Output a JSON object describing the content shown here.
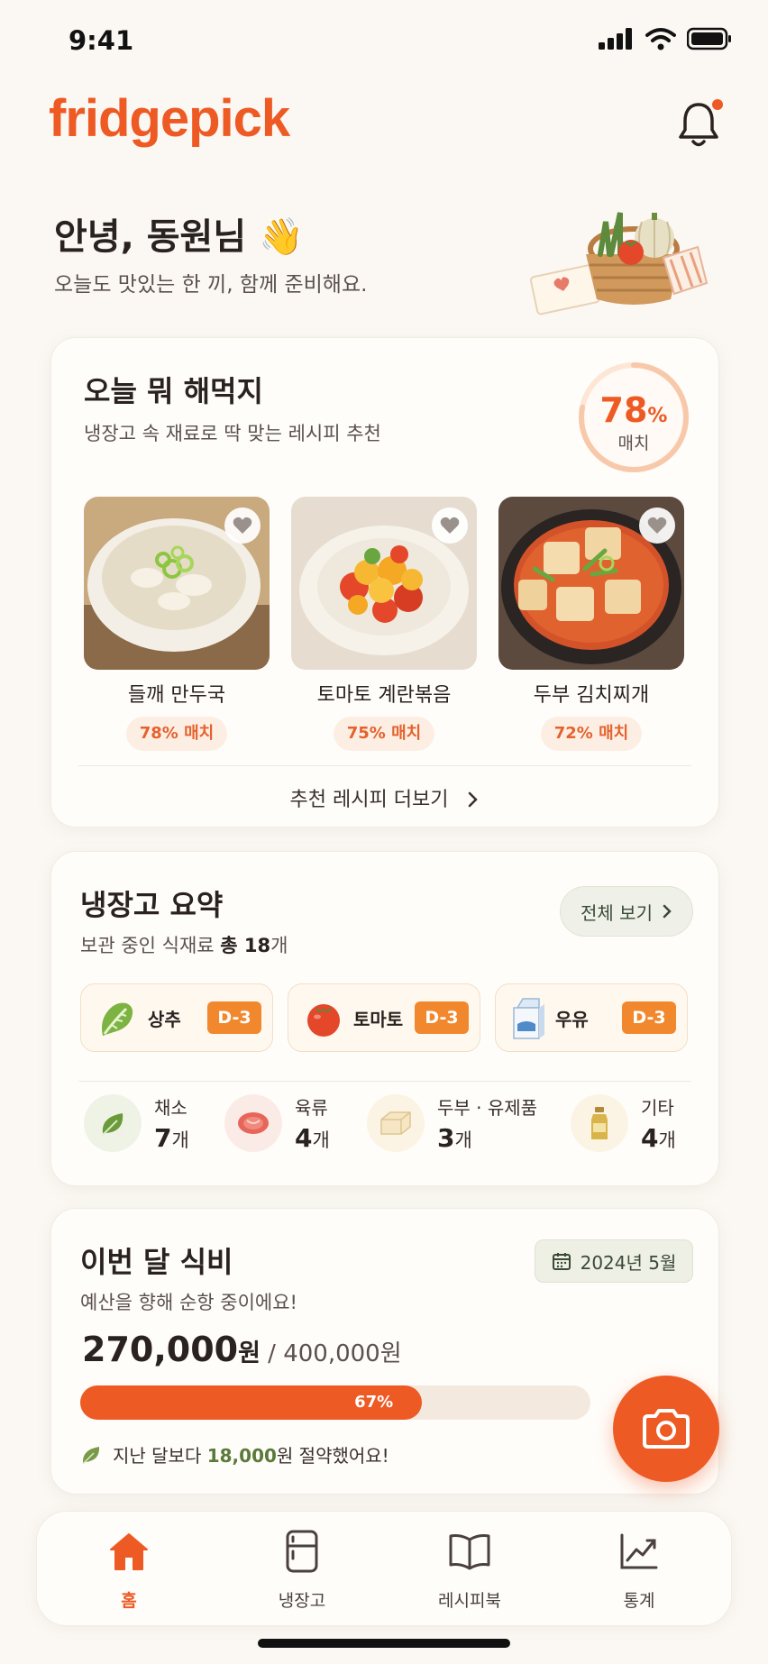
{
  "status": {
    "time": "9:41"
  },
  "app": {
    "logo": "fridgepick"
  },
  "greeting": {
    "title": "안녕, 동원님 👋",
    "subtitle": "오늘도 맛있는 한 끼, 함께 준비해요."
  },
  "recommend": {
    "title": "오늘 뭐 해먹지",
    "subtitle": "냉장고 속 재료로 딱 맞는 레시피 추천",
    "match_value": "78",
    "match_unit": "%",
    "match_label": "매치",
    "match_fraction": 0.78,
    "recipes": [
      {
        "name": "들깨 만두국",
        "badge": "78% 매치"
      },
      {
        "name": "토마토 계란볶음",
        "badge": "75% 매치"
      },
      {
        "name": "두부 김치찌개",
        "badge": "72% 매치"
      }
    ],
    "more": "추천 레시피 더보기"
  },
  "fridge": {
    "title": "냉장고 요약",
    "subtitle_prefix": "보관 중인 식재료 ",
    "subtitle_total": "총 18",
    "subtitle_suffix": "개",
    "view_all": "전체 보기",
    "expiring": [
      {
        "name": "상추",
        "dday": "D-3",
        "icon": "lettuce-icon"
      },
      {
        "name": "토마토",
        "dday": "D-3",
        "icon": "tomato-icon"
      },
      {
        "name": "우유",
        "dday": "D-3",
        "icon": "milk-icon"
      }
    ],
    "categories": [
      {
        "name": "채소",
        "count": "7",
        "unit": "개",
        "icon": "leaf-icon"
      },
      {
        "name": "육류",
        "count": "4",
        "unit": "개",
        "icon": "meat-icon"
      },
      {
        "name": "두부 · 유제품",
        "count": "3",
        "unit": "개",
        "icon": "tofu-icon"
      },
      {
        "name": "기타",
        "count": "4",
        "unit": "개",
        "icon": "bottle-icon"
      }
    ]
  },
  "budget": {
    "title": "이번 달 식비",
    "month": "2024년 5월",
    "subtitle": "예산을 향해 순항 중이에요!",
    "spent": "270,000",
    "spent_unit": "원",
    "limit": " / 400,000원",
    "progress_label": "67%",
    "progress_fraction": 0.67,
    "saving_prefix": "지난 달보다 ",
    "saving_amount": "18,000",
    "saving_suffix": "원 절약했어요!"
  },
  "tabs": [
    {
      "label": "홈",
      "icon": "home-icon",
      "active": true
    },
    {
      "label": "냉장고",
      "icon": "fridge-icon",
      "active": false
    },
    {
      "label": "레시피북",
      "icon": "book-icon",
      "active": false
    },
    {
      "label": "통계",
      "icon": "chart-icon",
      "active": false
    }
  ],
  "colors": {
    "accent": "#ee5a24",
    "dday": "#f2882e",
    "green": "#5b7a3a"
  }
}
